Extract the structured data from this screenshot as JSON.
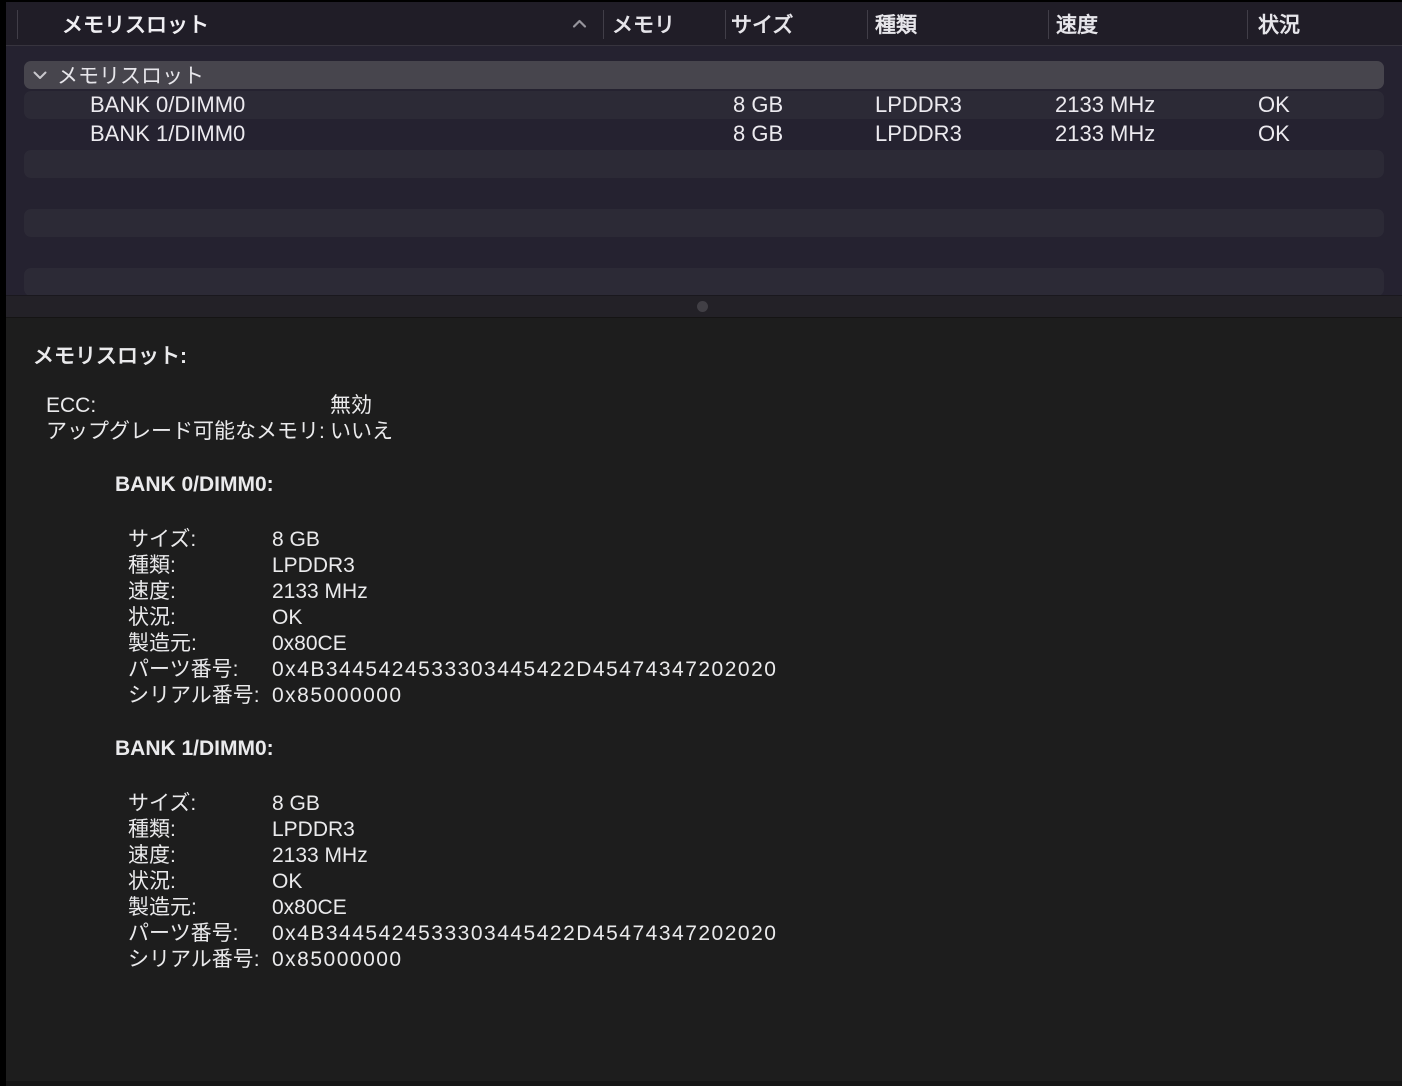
{
  "table": {
    "sort": {
      "column": "メモリスロット",
      "direction": "ascending"
    },
    "columns": [
      {
        "label": "メモリスロット"
      },
      {
        "label": "メモリ"
      },
      {
        "label": "サイズ"
      },
      {
        "label": "種類"
      },
      {
        "label": "速度"
      },
      {
        "label": "状況"
      }
    ],
    "group_row": {
      "label": "メモリスロット",
      "expanded": true
    },
    "rows": [
      {
        "slot": "BANK 0/DIMM0",
        "size": "8 GB",
        "type": "LPDDR3",
        "speed": "2133 MHz",
        "status": "OK"
      },
      {
        "slot": "BANK 1/DIMM0",
        "size": "8 GB",
        "type": "LPDDR3",
        "speed": "2133 MHz",
        "status": "OK"
      }
    ]
  },
  "detail": {
    "title": "メモリスロット:",
    "summary_rows": [
      {
        "label": "ECC:",
        "value": "無効"
      },
      {
        "label": "アップグレード可能なメモリ:",
        "value": "いいえ"
      }
    ],
    "banks": [
      {
        "heading": "BANK 0/DIMM0:",
        "rows": [
          {
            "label": "サイズ:",
            "value": "8 GB"
          },
          {
            "label": "種類:",
            "value": "LPDDR3"
          },
          {
            "label": "速度:",
            "value": "2133 MHz"
          },
          {
            "label": "状況:",
            "value": "OK"
          },
          {
            "label": "製造元:",
            "value": "0x80CE"
          },
          {
            "label": "パーツ番号:",
            "value": "0x4B3445424533303445422D45474347202020"
          },
          {
            "label": "シリアル番号:",
            "value": "0x85000000"
          }
        ]
      },
      {
        "heading": "BANK 1/DIMM0:",
        "rows": [
          {
            "label": "サイズ:",
            "value": "8 GB"
          },
          {
            "label": "種類:",
            "value": "LPDDR3"
          },
          {
            "label": "速度:",
            "value": "2133 MHz"
          },
          {
            "label": "状況:",
            "value": "OK"
          },
          {
            "label": "製造元:",
            "value": "0x80CE"
          },
          {
            "label": "パーツ番号:",
            "value": "0x4B3445424533303445422D45474347202020"
          },
          {
            "label": "シリアル番号:",
            "value": "0x85000000"
          }
        ]
      }
    ]
  },
  "colors": {
    "header_bg": "#201d27",
    "table_bg": "#252230",
    "row_stripe": "#2c2a36",
    "group_row_bg": "#47454d",
    "detail_bg": "#1d1d1d",
    "text": "#eceaef"
  }
}
